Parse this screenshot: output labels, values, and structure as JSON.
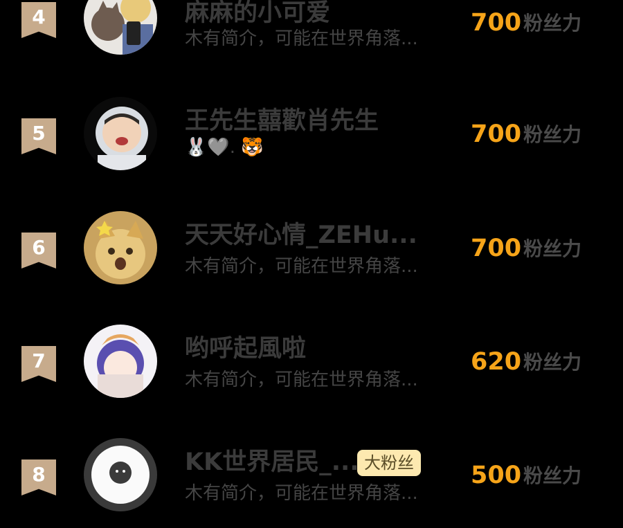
{
  "score_unit": "粉丝力",
  "fan_badge_label": "大粉丝",
  "rows": [
    {
      "rank": "4",
      "name": "麻麻的小可爱",
      "desc": "木有简介，可能在世界角落...",
      "score": "700"
    },
    {
      "rank": "5",
      "name": "王先生囍歡肖先生",
      "desc": "🐰🩶. 🐯",
      "score": "700"
    },
    {
      "rank": "6",
      "name": "天天好心情_ZEHu...",
      "desc": "木有简介，可能在世界角落...",
      "score": "700"
    },
    {
      "rank": "7",
      "name": "哟呼起風啦",
      "desc": "木有简介，可能在世界角落...",
      "score": "620"
    },
    {
      "rank": "8",
      "name": "KK世界居民_...",
      "desc": "木有简介，可能在世界角落...",
      "score": "500"
    }
  ],
  "colors": {
    "background": "#000000",
    "score": "#f6a419",
    "rank_badge": "#c7ab8c",
    "fan_badge": "#fde9b0"
  }
}
